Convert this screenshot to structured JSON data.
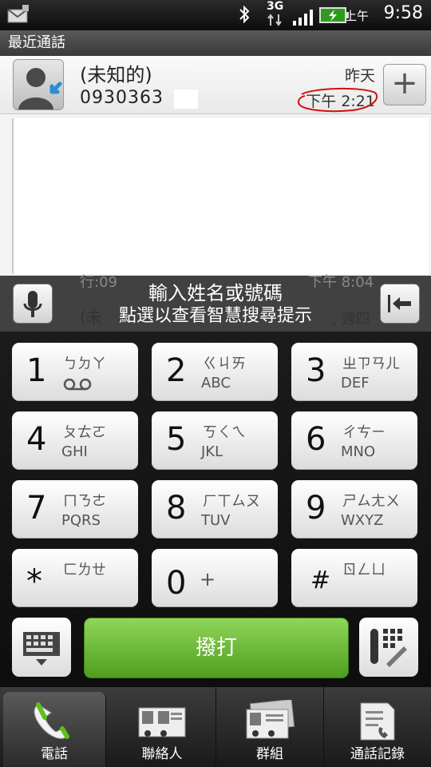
{
  "status_bar": {
    "network": "3G",
    "ampm": "上午",
    "time": "9:58"
  },
  "header": {
    "title": "最近通話"
  },
  "recent_calls": {
    "items": [
      {
        "name": "(未知的)",
        "number": "0930363",
        "date": "昨天",
        "time": "下午 2:21",
        "add_label": "+"
      }
    ],
    "ghost_rows": [
      {
        "text": "行:09",
        "time": "下午 8:04"
      },
      {
        "text": "(未",
        "time": ", 週四"
      }
    ]
  },
  "search": {
    "title": "輸入姓名或號碼",
    "hint": "點選以查看智慧搜尋提示"
  },
  "keypad": {
    "keys": [
      {
        "digit": "1",
        "bopo": "ㄅㄉㄚ",
        "letters": ""
      },
      {
        "digit": "2",
        "bopo": "ㄍㄐㄞ",
        "letters": "ABC"
      },
      {
        "digit": "3",
        "bopo": "ㄓㄗㄢㄦ",
        "letters": "DEF"
      },
      {
        "digit": "4",
        "bopo": "ㄆㄊㄛ",
        "letters": "GHI"
      },
      {
        "digit": "5",
        "bopo": "ㄎㄑㄟ",
        "letters": "JKL"
      },
      {
        "digit": "6",
        "bopo": "ㄔㄘㄧ",
        "letters": "MNO"
      },
      {
        "digit": "7",
        "bopo": "ㄇㄋㄜ",
        "letters": "PQRS"
      },
      {
        "digit": "8",
        "bopo": "ㄏㄒㄙㄡ",
        "letters": "TUV"
      },
      {
        "digit": "9",
        "bopo": "ㄕㄙㄤㄨ",
        "letters": "WXYZ"
      },
      {
        "digit": "*",
        "bopo": "ㄈㄌㄝ",
        "letters": ""
      },
      {
        "digit": "0",
        "bopo": "+",
        "letters": ""
      },
      {
        "digit": "#",
        "bopo": "ㄖㄥㄩ",
        "letters": ""
      }
    ],
    "call_label": "撥打"
  },
  "tabs": [
    {
      "label": "電話",
      "active": true
    },
    {
      "label": "聯絡人",
      "active": false
    },
    {
      "label": "群組",
      "active": false
    },
    {
      "label": "通話記錄",
      "active": false
    }
  ],
  "colors": {
    "call_green": "#6cba35",
    "annotation_red": "#d01010"
  }
}
